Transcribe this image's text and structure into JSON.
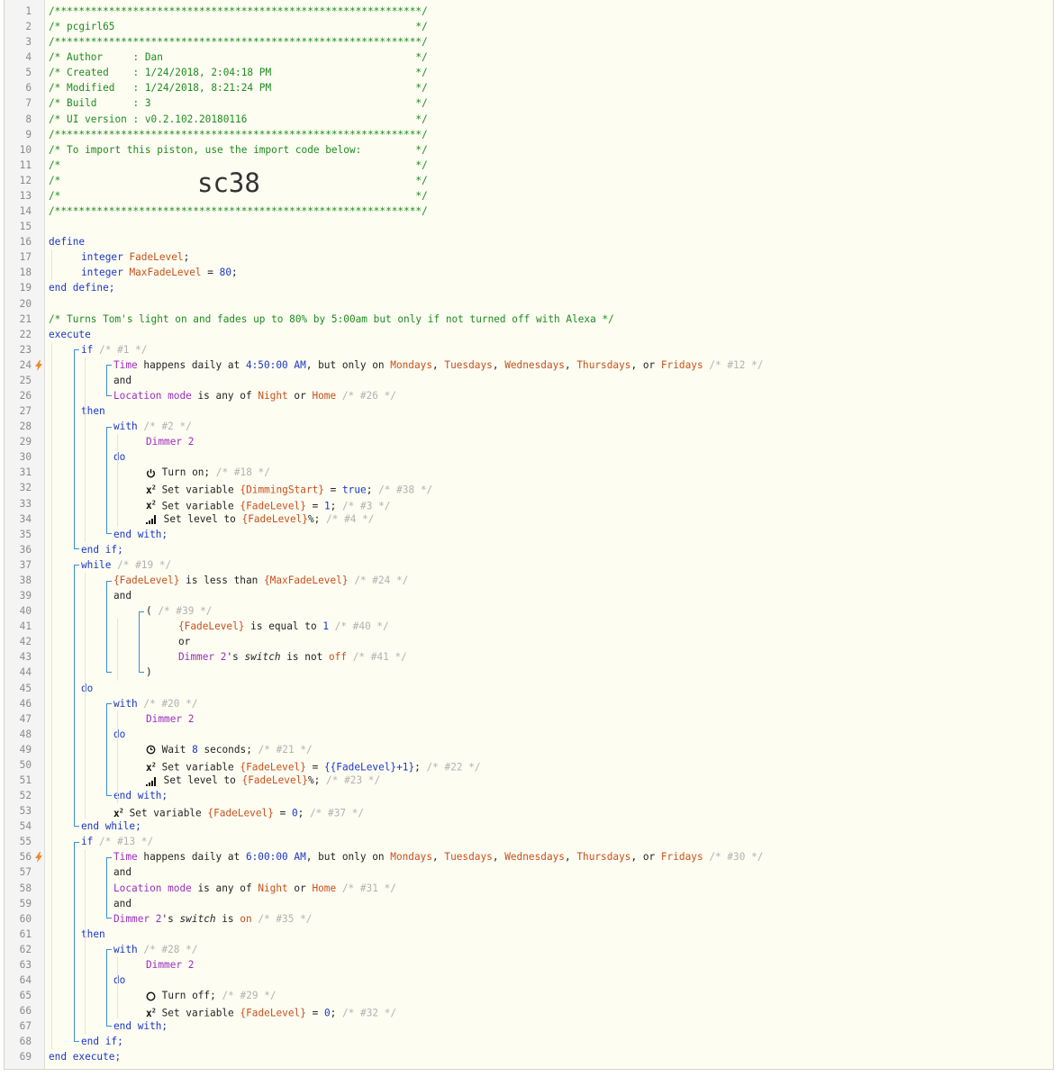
{
  "bolt_lines": [
    24,
    56
  ],
  "lines": [
    [
      [
        "g",
        "/*************************************************************/"
      ]
    ],
    [
      [
        "g",
        "/* pcgirl65                                                  */"
      ]
    ],
    [
      [
        "g",
        "/*************************************************************/"
      ]
    ],
    [
      [
        "g",
        "/* Author     : Dan                                          */"
      ]
    ],
    [
      [
        "g",
        "/* Created    : 1/24/2018, 2:04:18 PM                        */"
      ]
    ],
    [
      [
        "g",
        "/* Modified   : 1/24/2018, 8:21:24 PM                        */"
      ]
    ],
    [
      [
        "g",
        "/* Build      : 3                                            */"
      ]
    ],
    [
      [
        "g",
        "/* UI version : v0.2.102.20180116                            */"
      ]
    ],
    [
      [
        "g",
        "/*************************************************************/"
      ]
    ],
    [
      [
        "g",
        "/* To import this piston, use the import code below:         */"
      ]
    ],
    [
      [
        "g",
        "/*                                                           */"
      ]
    ],
    [
      [
        "g",
        "/*                                                           */"
      ]
    ],
    [
      [
        "g",
        "/*                                                           */"
      ]
    ],
    [
      [
        "g",
        "/*************************************************************/"
      ]
    ],
    [],
    [
      [
        "b",
        "define"
      ]
    ],
    [
      [
        "b",
        "integer "
      ],
      [
        "o",
        "FadeLevel"
      ],
      [
        "k",
        ";"
      ]
    ],
    [
      [
        "b",
        "integer "
      ],
      [
        "o",
        "MaxFadeLevel"
      ],
      [
        "k",
        " = "
      ],
      [
        "b",
        "80"
      ],
      [
        "k",
        ";"
      ]
    ],
    [
      [
        "b",
        "end define;"
      ]
    ],
    [],
    [
      [
        "g",
        "/* Turns Tom's light on and fades up to 80% by 5:00am but only if not turned off with Alexa */"
      ]
    ],
    [
      [
        "b",
        "execute"
      ]
    ],
    [
      [
        "b",
        "if "
      ],
      [
        "m",
        "/* #1 */"
      ]
    ],
    [
      [
        "p",
        "Time"
      ],
      [
        "k",
        " happens daily at "
      ],
      [
        "b",
        "4:50:00 AM"
      ],
      [
        "k",
        ", but only on "
      ],
      [
        "o",
        "Mondays"
      ],
      [
        "k",
        ", "
      ],
      [
        "o",
        "Tuesdays"
      ],
      [
        "k",
        ", "
      ],
      [
        "o",
        "Wednesdays"
      ],
      [
        "k",
        ", "
      ],
      [
        "o",
        "Thursdays"
      ],
      [
        "k",
        ", or "
      ],
      [
        "o",
        "Fridays"
      ],
      [
        "m",
        " /* #12 */"
      ]
    ],
    [
      [
        "k",
        "and"
      ]
    ],
    [
      [
        "p",
        "Location mode"
      ],
      [
        "k",
        " is any of "
      ],
      [
        "o",
        "Night"
      ],
      [
        "k",
        " or "
      ],
      [
        "o",
        "Home"
      ],
      [
        "m",
        " /* #26 */"
      ]
    ],
    [
      [
        "b",
        "then"
      ]
    ],
    [
      [
        "b",
        "with "
      ],
      [
        "m",
        "/* #2 */"
      ]
    ],
    [
      [
        "p",
        "Dimmer 2"
      ]
    ],
    [
      [
        "b",
        "do"
      ]
    ],
    [
      [
        "icon",
        "power"
      ],
      [
        "k",
        " Turn on; "
      ],
      [
        "m",
        "/* #18 */"
      ]
    ],
    [
      [
        "icon",
        "x2"
      ],
      [
        "k",
        " Set variable "
      ],
      [
        "o",
        "{DimmingStart}"
      ],
      [
        "k",
        " = "
      ],
      [
        "b",
        "true"
      ],
      [
        "k",
        "; "
      ],
      [
        "m",
        "/* #38 */"
      ]
    ],
    [
      [
        "icon",
        "x2"
      ],
      [
        "k",
        " Set variable "
      ],
      [
        "o",
        "{FadeLevel}"
      ],
      [
        "k",
        " = "
      ],
      [
        "b",
        "1"
      ],
      [
        "k",
        "; "
      ],
      [
        "m",
        "/* #3 */"
      ]
    ],
    [
      [
        "icon",
        "level"
      ],
      [
        "k",
        " Set level to "
      ],
      [
        "o",
        "{FadeLevel}"
      ],
      [
        "k",
        "%; "
      ],
      [
        "m",
        "/* #4 */"
      ]
    ],
    [
      [
        "b",
        "end with;"
      ]
    ],
    [
      [
        "b",
        "end if;"
      ]
    ],
    [
      [
        "b",
        "while "
      ],
      [
        "m",
        "/* #19 */"
      ]
    ],
    [
      [
        "o",
        "{FadeLevel}"
      ],
      [
        "k",
        " is less than "
      ],
      [
        "o",
        "{MaxFadeLevel}"
      ],
      [
        "m",
        " /* #24 */"
      ]
    ],
    [
      [
        "k",
        "and"
      ]
    ],
    [
      [
        "k",
        "( "
      ],
      [
        "m",
        "/* #39 */"
      ]
    ],
    [
      [
        "o",
        "{FadeLevel}"
      ],
      [
        "k",
        " is equal to "
      ],
      [
        "b",
        "1"
      ],
      [
        "m",
        " /* #40 */"
      ]
    ],
    [
      [
        "k",
        "or"
      ]
    ],
    [
      [
        "p",
        "Dimmer 2"
      ],
      [
        "k",
        "'s "
      ],
      [
        "ki",
        "switch"
      ],
      [
        "k",
        " is not "
      ],
      [
        "o",
        "off"
      ],
      [
        "m",
        " /* #41 */"
      ]
    ],
    [
      [
        "k",
        ")"
      ]
    ],
    [
      [
        "b",
        "do"
      ]
    ],
    [
      [
        "b",
        "with "
      ],
      [
        "m",
        "/* #20 */"
      ]
    ],
    [
      [
        "p",
        "Dimmer 2"
      ]
    ],
    [
      [
        "b",
        "do"
      ]
    ],
    [
      [
        "icon",
        "clock"
      ],
      [
        "k",
        " Wait "
      ],
      [
        "b",
        "8"
      ],
      [
        "k",
        " seconds; "
      ],
      [
        "m",
        "/* #21 */"
      ]
    ],
    [
      [
        "icon",
        "x2"
      ],
      [
        "k",
        " Set variable "
      ],
      [
        "o",
        "{FadeLevel}"
      ],
      [
        "k",
        " = "
      ],
      [
        "b",
        "{{FadeLevel}+1}"
      ],
      [
        "k",
        "; "
      ],
      [
        "m",
        "/* #22 */"
      ]
    ],
    [
      [
        "icon",
        "level"
      ],
      [
        "k",
        " Set level to "
      ],
      [
        "o",
        "{FadeLevel}"
      ],
      [
        "k",
        "%; "
      ],
      [
        "m",
        "/* #23 */"
      ]
    ],
    [
      [
        "b",
        "end with;"
      ]
    ],
    [
      [
        "icon",
        "x2"
      ],
      [
        "k",
        " Set variable "
      ],
      [
        "o",
        "{FadeLevel}"
      ],
      [
        "k",
        " = "
      ],
      [
        "b",
        "0"
      ],
      [
        "k",
        "; "
      ],
      [
        "m",
        "/* #37 */"
      ]
    ],
    [
      [
        "b",
        "end while;"
      ]
    ],
    [
      [
        "b",
        "if "
      ],
      [
        "m",
        "/* #13 */"
      ]
    ],
    [
      [
        "p",
        "Time"
      ],
      [
        "k",
        " happens daily at "
      ],
      [
        "b",
        "6:00:00 AM"
      ],
      [
        "k",
        ", but only on "
      ],
      [
        "o",
        "Mondays"
      ],
      [
        "k",
        ", "
      ],
      [
        "o",
        "Tuesdays"
      ],
      [
        "k",
        ", "
      ],
      [
        "o",
        "Wednesdays"
      ],
      [
        "k",
        ", "
      ],
      [
        "o",
        "Thursdays"
      ],
      [
        "k",
        ", or "
      ],
      [
        "o",
        "Fridays"
      ],
      [
        "m",
        " /* #30 */"
      ]
    ],
    [
      [
        "k",
        "and"
      ]
    ],
    [
      [
        "p",
        "Location mode"
      ],
      [
        "k",
        " is any of "
      ],
      [
        "o",
        "Night"
      ],
      [
        "k",
        " or "
      ],
      [
        "o",
        "Home"
      ],
      [
        "m",
        " /* #31 */"
      ]
    ],
    [
      [
        "k",
        "and"
      ]
    ],
    [
      [
        "p",
        "Dimmer 2"
      ],
      [
        "k",
        "'s "
      ],
      [
        "ki",
        "switch"
      ],
      [
        "k",
        " is "
      ],
      [
        "o",
        "on"
      ],
      [
        "m",
        " /* #35 */"
      ]
    ],
    [
      [
        "b",
        "then"
      ]
    ],
    [
      [
        "b",
        "with "
      ],
      [
        "m",
        "/* #28 */"
      ]
    ],
    [
      [
        "p",
        "Dimmer 2"
      ]
    ],
    [
      [
        "b",
        "do"
      ]
    ],
    [
      [
        "icon",
        "off"
      ],
      [
        "k",
        " Turn off; "
      ],
      [
        "m",
        "/* #29 */"
      ]
    ],
    [
      [
        "icon",
        "x2"
      ],
      [
        "k",
        " Set variable "
      ],
      [
        "o",
        "{FadeLevel}"
      ],
      [
        "k",
        " = "
      ],
      [
        "b",
        "0"
      ],
      [
        "k",
        "; "
      ],
      [
        "m",
        "/* #32 */"
      ]
    ],
    [
      [
        "b",
        "end with;"
      ]
    ],
    [
      [
        "b",
        "end if;"
      ]
    ],
    [
      [
        "b",
        "end execute;"
      ]
    ]
  ],
  "import_code": "sc38",
  "colors": {
    "comment": "#1e8c1e",
    "keyword": "#1a38c8",
    "value": "#c8501a",
    "device": "#9b2fbf",
    "id": "#b2b2b2",
    "bracket": "#3b8ed0",
    "bolt": "#f08a24"
  }
}
